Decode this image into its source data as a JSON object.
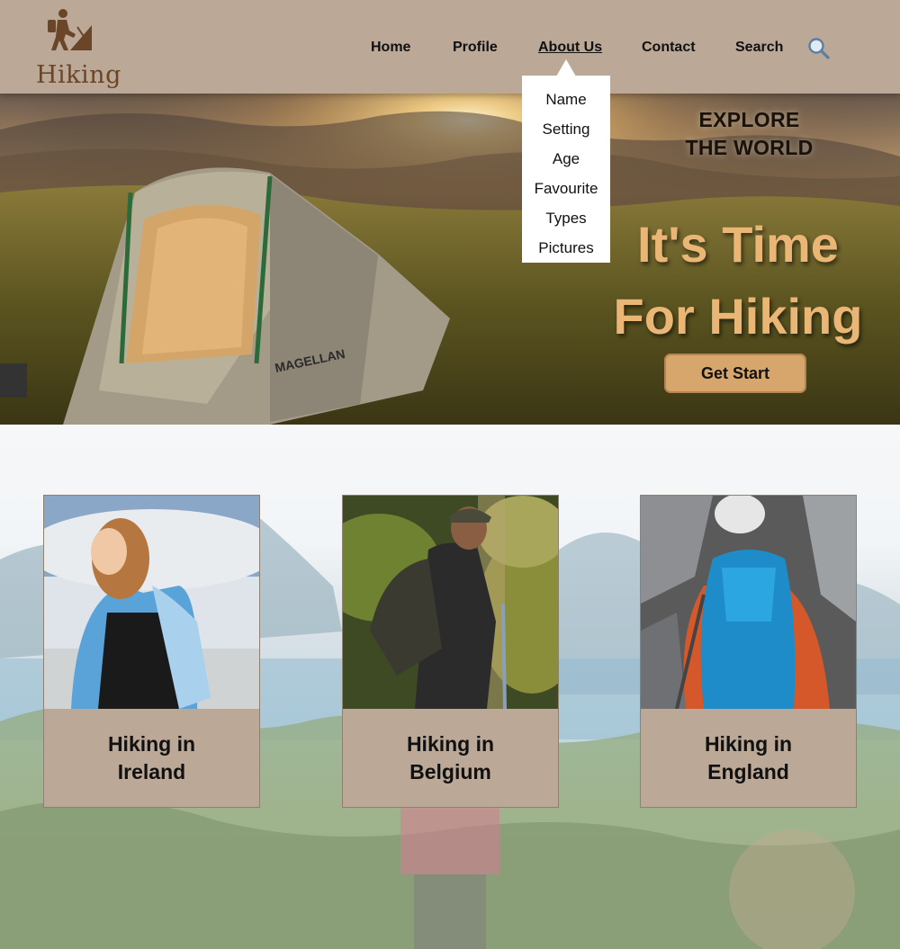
{
  "brand": {
    "name": "Hiking",
    "logo_icon": "hiker-climbing-icon"
  },
  "nav": {
    "items": [
      {
        "label": "Home",
        "active": false
      },
      {
        "label": "Profile",
        "active": false
      },
      {
        "label": "About Us",
        "active": true
      },
      {
        "label": "Contact",
        "active": false
      },
      {
        "label": "Search",
        "active": false
      }
    ],
    "search_icon": "magnifier-icon"
  },
  "dropdown": {
    "items": [
      "Name",
      "Setting",
      "Age",
      "Favourite",
      "Types",
      "Pictures"
    ]
  },
  "hero": {
    "subtitle_line1": "EXPLORE",
    "subtitle_line2": "THE WORLD",
    "title_line1": "It's Time",
    "title_line2": "For Hiking",
    "cta_label": "Get Start"
  },
  "cards": [
    {
      "line1": "Hiking in",
      "line2": "Ireland"
    },
    {
      "line1": "Hiking in",
      "line2": "Belgium"
    },
    {
      "line1": "Hiking in",
      "line2": "England"
    }
  ],
  "colors": {
    "header_bg": "#bba897",
    "logo_brown": "#6b4528",
    "cta_bg": "#d6a66d",
    "hero_title": "#e9b676",
    "card_caption_bg": "#bba897"
  }
}
